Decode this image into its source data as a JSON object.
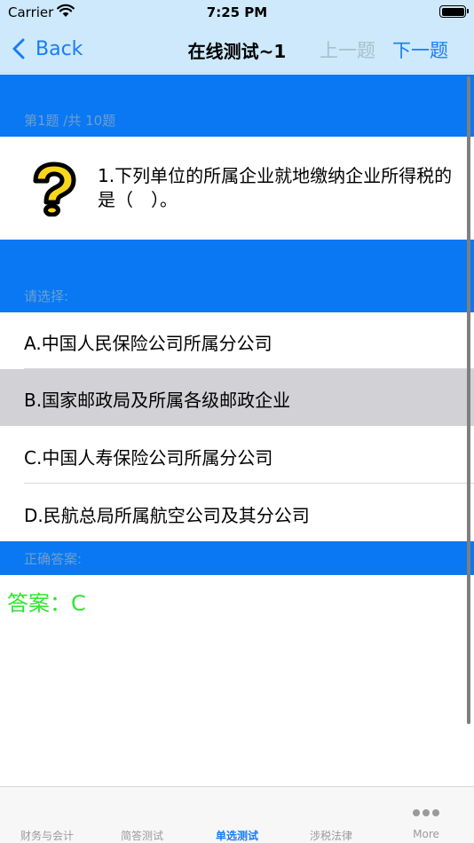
{
  "status_bar": {
    "carrier": "Carrier",
    "time": "7:25 PM"
  },
  "nav": {
    "back_label": "Back",
    "title": "在线测试~1",
    "prev_label": "上一题",
    "next_label": "下一题"
  },
  "quiz": {
    "progress_label": "第1题 /共 10题",
    "question": "1.下列单位的所属企业就地缴纳企业所得税的是（　）。",
    "choose_label": "请选择:",
    "options": [
      {
        "label": "A.中国人民保险公司所属分公司",
        "selected": false
      },
      {
        "label": "B.国家邮政局及所属各级邮政企业",
        "selected": true
      },
      {
        "label": "C.中国人寿保险公司所属分公司",
        "selected": false
      },
      {
        "label": "D.民航总局所属航空公司及其分公司",
        "selected": false
      }
    ],
    "correct_label": "正确答案:",
    "answer": "答案：C"
  },
  "tabs": [
    {
      "label": "财务与会计",
      "active": false
    },
    {
      "label": "简答测试",
      "active": false
    },
    {
      "label": "单选测试",
      "active": true
    },
    {
      "label": "涉税法律",
      "active": false
    },
    {
      "label": "More",
      "active": false,
      "icon": "more-dots-icon"
    }
  ],
  "colors": {
    "accent": "#1a7cf6",
    "section": "#0a78f2",
    "bar": "#cde9fb",
    "answer": "#32e432"
  }
}
